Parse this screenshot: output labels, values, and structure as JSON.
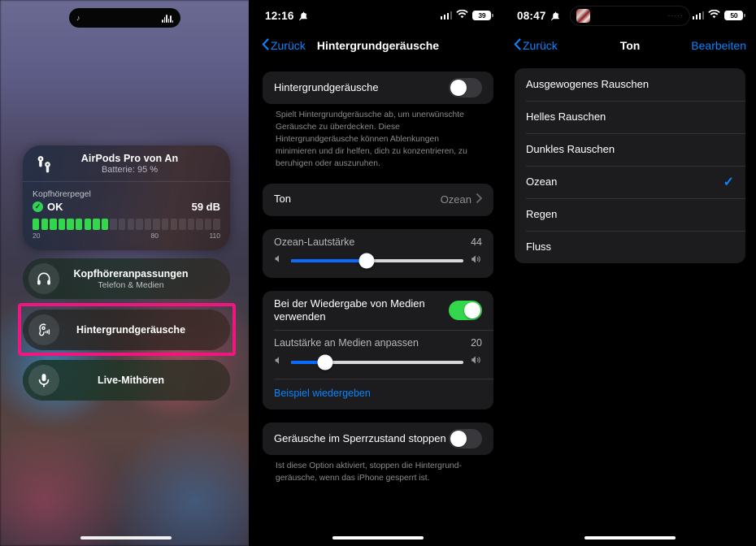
{
  "panel1": {
    "dynamic_island": {
      "left_icon": "music-note-icon",
      "right_icon": "audio-waveform-icon"
    },
    "device_card": {
      "icon": "airpods-pro-icon",
      "title": "AirPods Pro von An",
      "subtitle": "Batterie: 95 %",
      "level_label": "Kopfhörerpegel",
      "status_text": "OK",
      "status_icon": "check-circle-icon",
      "db_value": "59 dB",
      "bars_total": 22,
      "bars_lit": 9,
      "scale": [
        "20",
        "80",
        "110"
      ],
      "status_color": "#32d74b"
    },
    "rows": [
      {
        "icon": "headphones-icon",
        "label": "Kopfhöreranpassungen",
        "sub": "Telefon & Medien"
      },
      {
        "icon": "background-sounds-icon",
        "label": "Hintergrundgeräusche",
        "sub": ""
      },
      {
        "icon": "microphone-icon",
        "label": "Live-Mithören",
        "sub": ""
      }
    ],
    "highlight_color": "#f3157f"
  },
  "panel2": {
    "status": {
      "time": "12:16",
      "mute_icon": "bell-slash-icon",
      "signal_icon": "cellular-signal-icon",
      "wifi_icon": "wifi-icon",
      "battery": "39"
    },
    "nav": {
      "back_label": "Zurück",
      "back_icon": "chevron-left-icon",
      "title": "Hintergrundgeräusche"
    },
    "main_toggle": {
      "label": "Hintergrundgeräusche",
      "on": false
    },
    "main_footnote": "Spielt Hintergrundgeräusche ab, um unerwünschte Geräusche zu überdecken. Diese Hintergrundgeräusche können Ablenkungen minimieren und dir helfen, dich zu konzentrieren, zu beruhigen oder auszuruhen.",
    "sound_row": {
      "label": "Ton",
      "value": "Ozean",
      "chevron": "chevron-right-icon"
    },
    "volume_slider": {
      "title": "Ozean-Lautstärke",
      "value": "44",
      "percent": 44,
      "min_icon": "speaker-low-icon",
      "max_icon": "speaker-high-icon"
    },
    "media_toggle": {
      "label": "Bei der Wiedergabe von Medien verwenden",
      "on": true
    },
    "media_slider": {
      "title": "Lautstärke an Medien anpassen",
      "value": "20",
      "percent": 20,
      "min_icon": "speaker-low-icon",
      "max_icon": "speaker-high-icon"
    },
    "sample_link": "Beispiel wiedergeben",
    "lock_toggle": {
      "label": "Geräusche im Sperrzustand stoppen",
      "on": false
    },
    "lock_footnote": "Ist diese Option aktiviert, stoppen die Hintergrund- geräusche, wenn das iPhone gesperrt ist."
  },
  "panel3": {
    "status": {
      "time": "08:47",
      "mute_icon": "bell-slash-icon",
      "signal_icon": "cellular-signal-icon",
      "wifi_icon": "wifi-icon",
      "battery": "50"
    },
    "dynamic_island": {
      "thumb_icon": "media-artwork-icon",
      "dots": "·····"
    },
    "nav": {
      "back_label": "Zurück",
      "back_icon": "chevron-left-icon",
      "title": "Ton",
      "edit_label": "Bearbeiten"
    },
    "options": [
      {
        "label": "Ausgewogenes Rauschen",
        "selected": false
      },
      {
        "label": "Helles Rauschen",
        "selected": false
      },
      {
        "label": "Dunkles Rauschen",
        "selected": false
      },
      {
        "label": "Ozean",
        "selected": true
      },
      {
        "label": "Regen",
        "selected": false
      },
      {
        "label": "Fluss",
        "selected": false
      }
    ],
    "check_icon": "checkmark-icon",
    "accent_color": "#0a84ff"
  }
}
